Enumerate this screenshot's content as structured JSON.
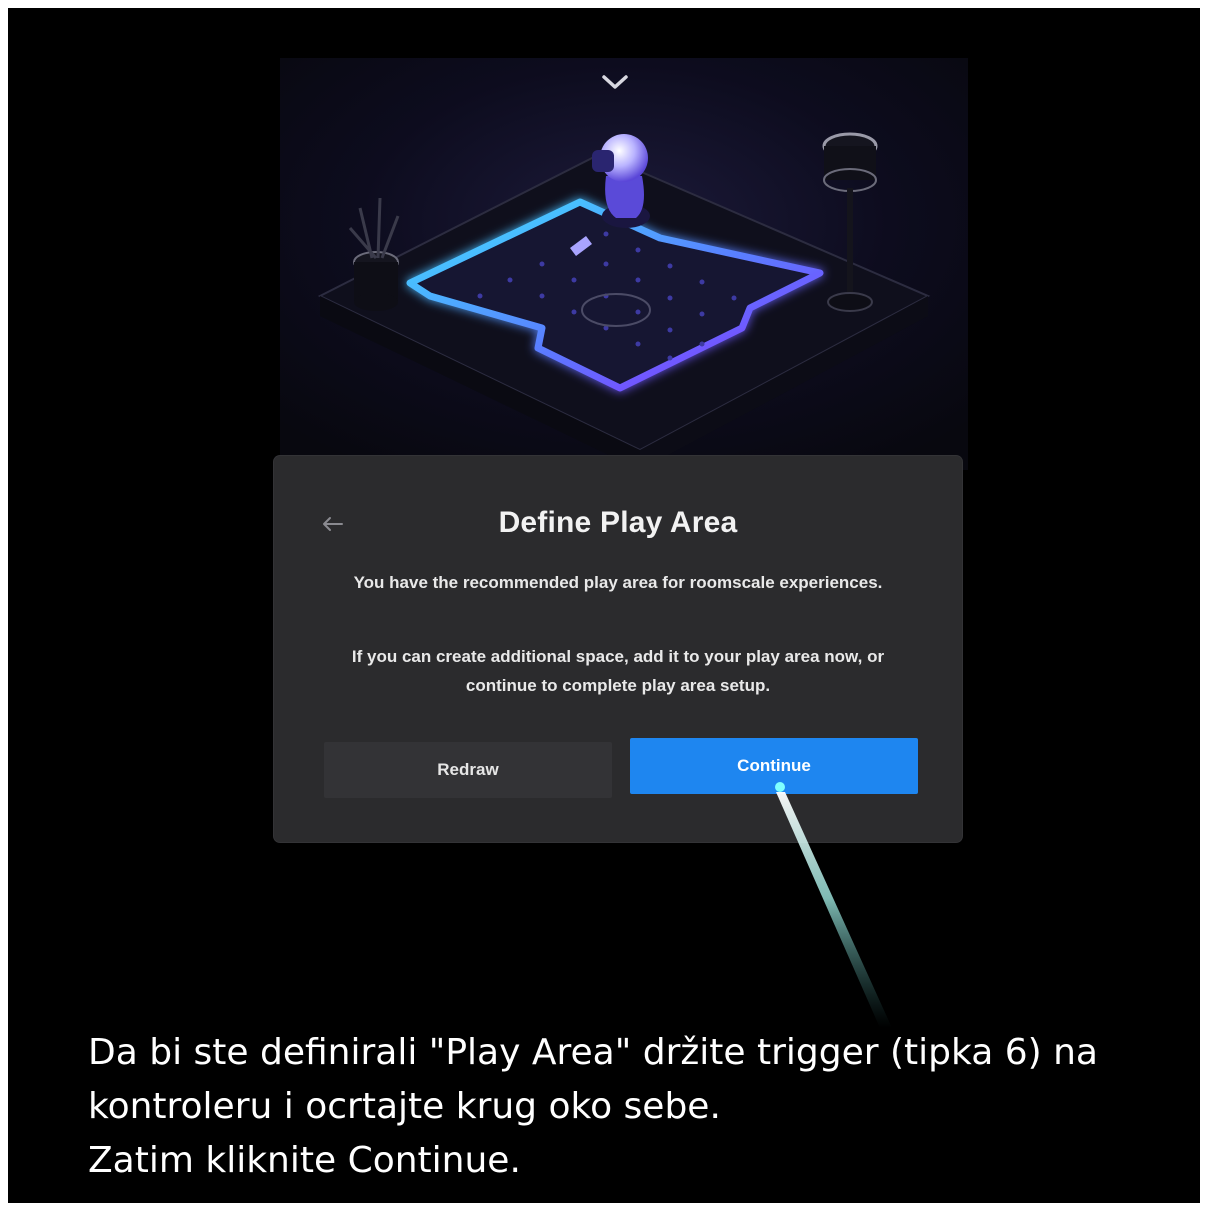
{
  "dialog": {
    "title": "Define Play Area",
    "paragraph1": "You have the recommended play area for roomscale experiences.",
    "paragraph2": "If you can create additional space, add it to your play area now, or continue to complete play area setup.",
    "redraw_label": "Redraw",
    "continue_label": "Continue"
  },
  "icons": {
    "back": "back-arrow-icon",
    "collapse": "chevron-down-icon"
  },
  "caption": {
    "line1": "Da bi ste definirali \"Play Area\" držite trigger (tipka 6) na",
    "line2": "kontroleru i ocrtajte krug oko sebe.",
    "line3": "Zatim kliknite Continue."
  },
  "colors": {
    "background": "#000000",
    "dialog": "#2b2b2d",
    "accent": "#1e86f0",
    "boundary_cyan": "#45e0ff",
    "boundary_violet": "#7a3cff"
  }
}
